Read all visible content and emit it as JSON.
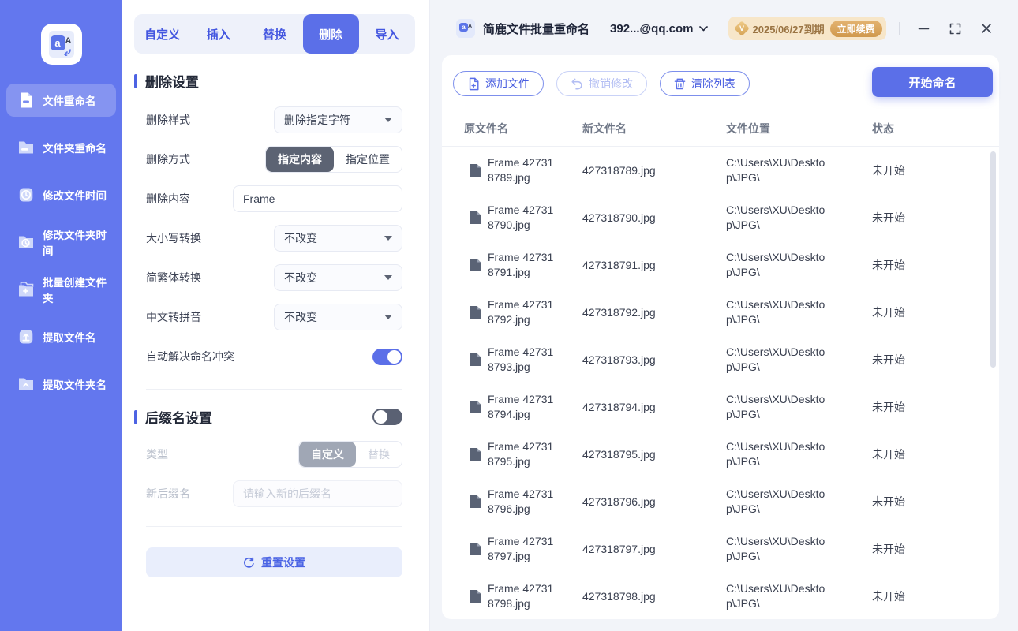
{
  "logo": {
    "a": "a",
    "A": "A",
    "vip_letter": "V"
  },
  "sidebar": {
    "items": [
      {
        "key": "file-rename",
        "icon": "file-rename-icon",
        "label": "文件重命名",
        "active": true
      },
      {
        "key": "folder-rename",
        "icon": "folder-rename-icon",
        "label": "文件夹重命名"
      },
      {
        "key": "file-time",
        "icon": "file-time-icon",
        "label": "修改文件时间"
      },
      {
        "key": "folder-time",
        "icon": "folder-time-icon",
        "label": "修改文件夹时间"
      },
      {
        "key": "folder-create",
        "icon": "folder-create-icon",
        "label": "批量创建文件夹"
      },
      {
        "key": "extract-filename",
        "icon": "extract-filename-icon",
        "label": "提取文件名"
      },
      {
        "key": "extract-foldername",
        "icon": "extract-foldername-icon",
        "label": "提取文件夹名"
      }
    ]
  },
  "tabs": {
    "items": [
      {
        "key": "custom",
        "label": "自定义"
      },
      {
        "key": "insert",
        "label": "插入"
      },
      {
        "key": "replace",
        "label": "替换"
      },
      {
        "key": "delete",
        "label": "删除",
        "active": true
      },
      {
        "key": "import",
        "label": "导入"
      }
    ]
  },
  "delete_settings": {
    "heading": "删除设置",
    "style_label": "删除样式",
    "style_value": "删除指定字符",
    "mode_label": "删除方式",
    "mode_active": "指定内容",
    "mode_inactive": "指定位置",
    "content_label": "删除内容",
    "content_value": "Frame",
    "case_label": "大小写转换",
    "case_value": "不改变",
    "st_label": "简繁体转换",
    "st_value": "不改变",
    "pinyin_label": "中文转拼音",
    "pinyin_value": "不改变",
    "conflict_label": "自动解决命名冲突"
  },
  "suffix_settings": {
    "heading": "后缀名设置",
    "type_label": "类型",
    "type_active": "自定义",
    "type_inactive": "替换",
    "suffix_label": "新后缀名",
    "suffix_placeholder": "请输入新的后缀名"
  },
  "reset_label": "重置设置",
  "titlebar": {
    "title": "简鹿文件批量重命名",
    "account": "392...@qq.com",
    "expiry": "2025/06/27到期",
    "renew_label": "立即续费"
  },
  "toolbar": {
    "add_label": "添加文件",
    "undo_label": "撤销修改",
    "clear_label": "清除列表",
    "start_label": "开始命名"
  },
  "table": {
    "headers": {
      "original": "原文件名",
      "new_name": "新文件名",
      "location": "文件位置",
      "status": "状态"
    },
    "rows": [
      {
        "original": "Frame 427318789.jpg",
        "new_name": "427318789.jpg",
        "location": "C:\\Users\\XU\\Desktop\\JPG\\",
        "status": "未开始"
      },
      {
        "original": "Frame 427318790.jpg",
        "new_name": "427318790.jpg",
        "location": "C:\\Users\\XU\\Desktop\\JPG\\",
        "status": "未开始"
      },
      {
        "original": "Frame 427318791.jpg",
        "new_name": "427318791.jpg",
        "location": "C:\\Users\\XU\\Desktop\\JPG\\",
        "status": "未开始"
      },
      {
        "original": "Frame 427318792.jpg",
        "new_name": "427318792.jpg",
        "location": "C:\\Users\\XU\\Desktop\\JPG\\",
        "status": "未开始"
      },
      {
        "original": "Frame 427318793.jpg",
        "new_name": "427318793.jpg",
        "location": "C:\\Users\\XU\\Desktop\\JPG\\",
        "status": "未开始"
      },
      {
        "original": "Frame 427318794.jpg",
        "new_name": "427318794.jpg",
        "location": "C:\\Users\\XU\\Desktop\\JPG\\",
        "status": "未开始"
      },
      {
        "original": "Frame 427318795.jpg",
        "new_name": "427318795.jpg",
        "location": "C:\\Users\\XU\\Desktop\\JPG\\",
        "status": "未开始"
      },
      {
        "original": "Frame 427318796.jpg",
        "new_name": "427318796.jpg",
        "location": "C:\\Users\\XU\\Desktop\\JPG\\",
        "status": "未开始"
      },
      {
        "original": "Frame 427318797.jpg",
        "new_name": "427318797.jpg",
        "location": "C:\\Users\\XU\\Desktop\\JPG\\",
        "status": "未开始"
      },
      {
        "original": "Frame 427318798.jpg",
        "new_name": "427318798.jpg",
        "location": "C:\\Users\\XU\\Desktop\\JPG\\",
        "status": "未开始"
      }
    ]
  },
  "colors": {
    "accent": "#5B6FE8",
    "sidebar": "#6377EE",
    "badge_bg": "#F7E6C9",
    "badge_text": "#9A7443",
    "renew_bg": "#D9A75F"
  }
}
